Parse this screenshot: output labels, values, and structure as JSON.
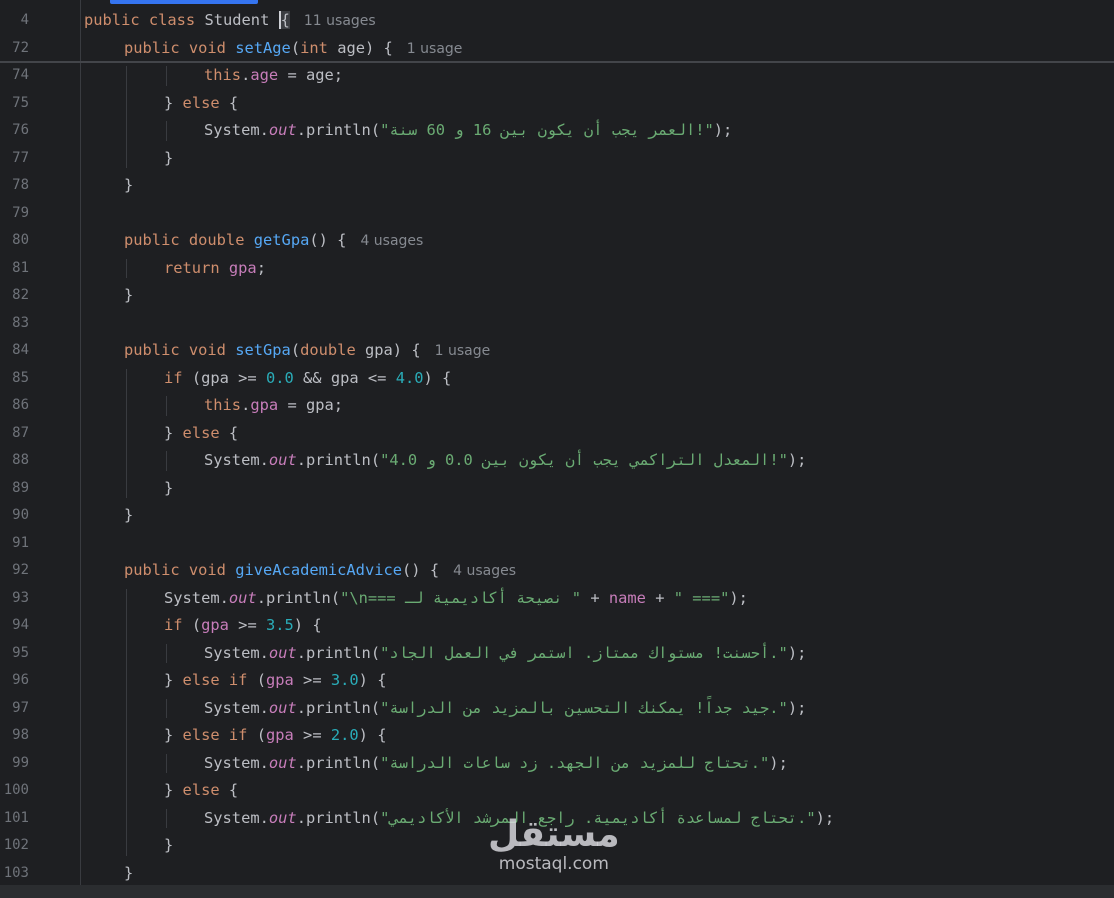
{
  "editor": {
    "sticky": [
      {
        "n": "4",
        "html": "<span class=\"kw\">public class</span> Student <span class=\"cursor\">{</span>",
        "hint": "11 usages"
      },
      {
        "n": "72",
        "html": "<span class=\"kw\">public void</span> <span class=\"fn\">setAge</span>(<span class=\"kw\">int</span> age) {",
        "hint": "1 usage"
      }
    ],
    "lines": [
      {
        "n": "74",
        "indent": 3,
        "html": "<span class=\"kw\">this</span>.<span class=\"fld\">age</span> = age;"
      },
      {
        "n": "75",
        "indent": 2,
        "html": "} <span class=\"kw\">else</span> {"
      },
      {
        "n": "76",
        "indent": 3,
        "html": "System.<span class=\"st\">out</span>.println(<span class=\"str\">\"العمر يجب أن يكون بين 16 و 60 سنة!\"</span>);"
      },
      {
        "n": "77",
        "indent": 2,
        "html": "}"
      },
      {
        "n": "78",
        "indent": 1,
        "html": "}"
      },
      {
        "n": "79",
        "indent": 0,
        "html": ""
      },
      {
        "n": "80",
        "indent": 1,
        "html": "<span class=\"kw\">public double</span> <span class=\"fn\">getGpa</span>() {",
        "hint": "4 usages"
      },
      {
        "n": "81",
        "indent": 2,
        "html": "<span class=\"kw\">return</span> <span class=\"fld\">gpa</span>;"
      },
      {
        "n": "82",
        "indent": 1,
        "html": "}"
      },
      {
        "n": "83",
        "indent": 0,
        "html": ""
      },
      {
        "n": "84",
        "indent": 1,
        "html": "<span class=\"kw\">public void</span> <span class=\"fn\">setGpa</span>(<span class=\"kw\">double</span> gpa) {",
        "hint": "1 usage"
      },
      {
        "n": "85",
        "indent": 2,
        "html": "<span class=\"kw\">if</span> (gpa &gt;= <span class=\"num\">0.0</span> &amp;&amp; gpa &lt;= <span class=\"num\">4.0</span>) {"
      },
      {
        "n": "86",
        "indent": 3,
        "html": "<span class=\"kw\">this</span>.<span class=\"fld\">gpa</span> = gpa;"
      },
      {
        "n": "87",
        "indent": 2,
        "html": "} <span class=\"kw\">else</span> {"
      },
      {
        "n": "88",
        "indent": 3,
        "html": "System.<span class=\"st\">out</span>.println(<span class=\"str\">\"المعدل التراكمي يجب أن يكون بين 0.0 و 4.0!\"</span>);"
      },
      {
        "n": "89",
        "indent": 2,
        "html": "}"
      },
      {
        "n": "90",
        "indent": 1,
        "html": "}"
      },
      {
        "n": "91",
        "indent": 0,
        "html": ""
      },
      {
        "n": "92",
        "indent": 1,
        "html": "<span class=\"kw\">public void</span> <span class=\"fn\">giveAcademicAdvice</span>() {",
        "hint": "4 usages"
      },
      {
        "n": "93",
        "indent": 2,
        "html": "System.<span class=\"st\">out</span>.println(<span class=\"str\">\"\\n=== نصيحة أكاديمية لـ \"</span> + <span class=\"fld\">name</span> + <span class=\"str\">\" ===\"</span>);"
      },
      {
        "n": "94",
        "indent": 2,
        "html": "<span class=\"kw\">if</span> (<span class=\"fld\">gpa</span> &gt;= <span class=\"num\">3.5</span>) {"
      },
      {
        "n": "95",
        "indent": 3,
        "html": "System.<span class=\"st\">out</span>.println(<span class=\"str\">\"أحسنت! مستواك ممتاز. استمر في العمل الجاد.\"</span>);"
      },
      {
        "n": "96",
        "indent": 2,
        "html": "} <span class=\"kw\">else if</span> (<span class=\"fld\">gpa</span> &gt;= <span class=\"num\">3.0</span>) {"
      },
      {
        "n": "97",
        "indent": 3,
        "html": "System.<span class=\"st\">out</span>.println(<span class=\"str\">\"جيد جداً! يمكنك التحسين بالمزيد من الدراسة.\"</span>);"
      },
      {
        "n": "98",
        "indent": 2,
        "html": "} <span class=\"kw\">else if</span> (<span class=\"fld\">gpa</span> &gt;= <span class=\"num\">2.0</span>) {"
      },
      {
        "n": "99",
        "indent": 3,
        "html": "System.<span class=\"st\">out</span>.println(<span class=\"str\">\"تحتاج للمزيد من الجهد. زد ساعات الدراسة.\"</span>);"
      },
      {
        "n": "100",
        "indent": 2,
        "html": "} <span class=\"kw\">else</span> {"
      },
      {
        "n": "101",
        "indent": 3,
        "html": "System.<span class=\"st\">out</span>.println(<span class=\"str\">\"تحتاج لمساعدة أكاديمية. راجع المرشد الأكاديمي.\"</span>);"
      },
      {
        "n": "102",
        "indent": 2,
        "html": "}"
      },
      {
        "n": "103",
        "indent": 1,
        "html": "}"
      }
    ]
  },
  "watermark": {
    "arabic": "مستقل",
    "latin": "mostaql.com"
  }
}
